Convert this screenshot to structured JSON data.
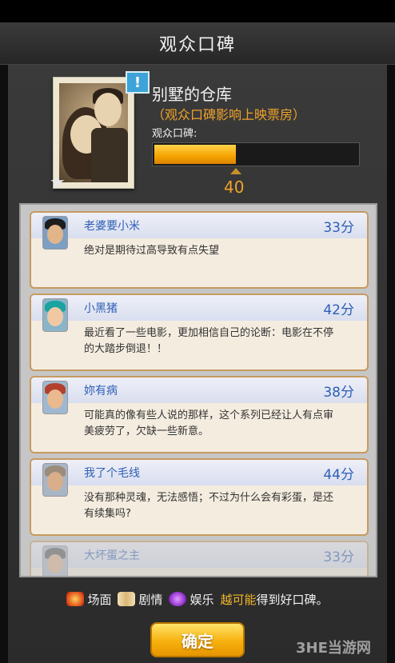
{
  "header": {
    "title": "观众口碑"
  },
  "movie": {
    "title": "别墅的仓库",
    "subtitle": "（观众口碑影响上映票房）",
    "reputation_label": "观众口碑:",
    "reputation_value": "40",
    "reputation_fraction": 0.4,
    "alert": "!"
  },
  "reviews": [
    {
      "name": "老婆要小米",
      "score": "33分",
      "text": "绝对是期待过高导致有点失望"
    },
    {
      "name": "小黑猪",
      "score": "42分",
      "text": "最近看了一些电影，更加相信自己的论断：电影在不停的大踏步倒退！！"
    },
    {
      "name": "妳有病",
      "score": "38分",
      "text": "可能真的像有些人说的那样，这个系列已经让人有点审美疲劳了，欠缺一些新意。"
    },
    {
      "name": "我了个毛线",
      "score": "44分",
      "text": "没有那种灵魂，无法感悟；不过为什么会有彩蛋，是还有续集吗?"
    },
    {
      "name": "大坏蛋之主",
      "score": "33分",
      "text": ""
    }
  ],
  "footer": {
    "tags": [
      "场面",
      "剧情",
      "娱乐"
    ],
    "highlight": "越可能",
    "suffix": "得到好口碑。",
    "confirm_label": "确定",
    "watermark": "3HE当游网"
  },
  "colors": {
    "accent": "#f1a22a",
    "name_blue": "#2e5fb5"
  }
}
